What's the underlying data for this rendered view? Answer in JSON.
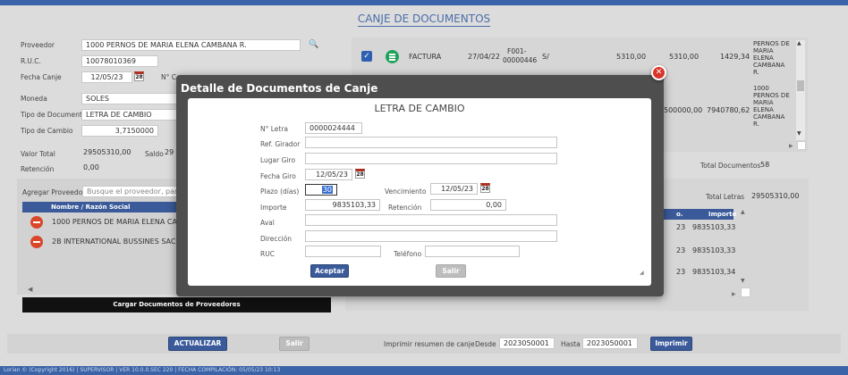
{
  "header": {
    "title": "CANJE DE DOCUMENTOS"
  },
  "form": {
    "proveedor_label": "Proveedor",
    "proveedor_value": "1000 PERNOS DE MARIA ELENA CAMBANA R.",
    "ruc_label": "R.U.C.",
    "ruc_value": "10078010369",
    "fecha_canje_label": "Fecha Canje",
    "fecha_canje_value": "12/05/23",
    "numero_label": "N° C",
    "moneda_label": "Moneda",
    "moneda_value": "SOLES",
    "tipo_doc_label": "Tipo de Documento",
    "tipo_doc_value": "LETRA DE CAMBIO",
    "tipo_cambio_label": "Tipo de Cambio",
    "tipo_cambio_value": "3,7150000",
    "valor_total_label": "Valor Total",
    "valor_total_value": "29505310,00",
    "saldo_label": "Saldo",
    "saldo_value": "29",
    "retencion_label": "Retención",
    "retencion_value": "0,00"
  },
  "providers": {
    "add_label": "Agregar Proveedor",
    "search_placeholder": "Busque el proveedor, para",
    "column_header": "Nombre / Razón Social",
    "rows": [
      "1000 PERNOS DE MARIA ELENA CAMI",
      "2B INTERNATIONAL BUSSINES SAC"
    ],
    "load_button": "Cargar Documentos de Proveedores"
  },
  "documents": {
    "row1": {
      "tipo": "FACTURA",
      "fecha": "27/04/22",
      "serie": "F001-",
      "numero": "00000446",
      "moneda": "S/",
      "total": "5310,00",
      "saldo": "5310,00",
      "canje": "1429,34",
      "proveedor": "PERNOS DE MARIA ELENA CAMBANA R."
    },
    "row2": {
      "total": "500000,00",
      "canje": "7940780,62",
      "proveedor": "1000 PERNOS DE MARIA ELENA CAMBANA R."
    },
    "total_docs_label": "Total Documentos",
    "total_docs_value": "58"
  },
  "letras": {
    "total_label": "Total Letras",
    "total_value": "29505310,00",
    "col_no": "o.",
    "col_importe": "Importe",
    "rows": [
      {
        "no": "23",
        "importe": "9835103,33"
      },
      {
        "no": "23",
        "importe": "9835103,33"
      },
      {
        "no": "23",
        "importe": "9835103,34"
      }
    ]
  },
  "bottom": {
    "actualizar": "ACTUALIZAR",
    "salir": "Salir",
    "imprimir_label": "Imprimir resumen de canje",
    "desde_label": "Desde",
    "desde_value": "2023050001",
    "hasta_label": "Hasta",
    "hasta_value": "2023050001",
    "imprimir_button": "Imprimir"
  },
  "modal": {
    "title": "Detalle de Documentos de Canje",
    "subtitle": "LETRA DE CAMBIO",
    "nro_letra_label": "N° Letra",
    "nro_letra_value": "0000024444",
    "ref_girador_label": "Ref. Girador",
    "lugar_giro_label": "Lugar Giro",
    "fecha_giro_label": "Fecha Giro",
    "fecha_giro_value": "12/05/23",
    "plazo_label": "Plazo (días)",
    "plazo_value": "30",
    "vencimiento_label": "Vencimiento",
    "vencimiento_value": "12/05/23",
    "importe_label": "Importe",
    "importe_value": "9835103,33",
    "retencion_label": "Retención",
    "retencion_value": "0,00",
    "aval_label": "Aval",
    "direccion_label": "Dirección",
    "ruc_label": "RUC",
    "telefono_label": "Teléfono",
    "aceptar": "Aceptar",
    "salir": "Salir",
    "calendar_glyph": "28"
  },
  "footer": {
    "text": "Lorian © (Copyright 2016) | SUPERVISOR | VER 10.0.0.SEC 220 | FECHA COMPILACIÓN: 05/05/23 10:13"
  },
  "colors": {
    "accent": "#3a5a9a",
    "danger": "#d9462a",
    "success": "#1fa35a",
    "topbar": "#3a63a8"
  }
}
